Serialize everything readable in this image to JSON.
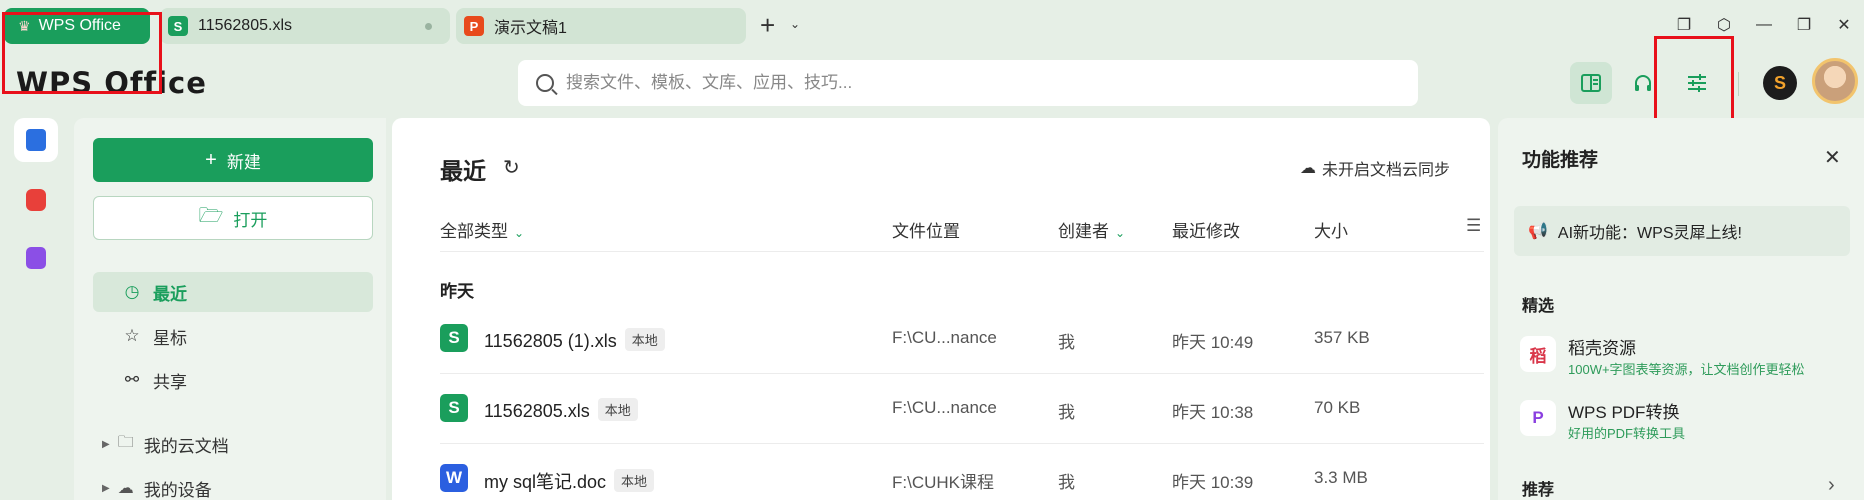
{
  "tabs": [
    {
      "label": "WPS Office",
      "icon": "wps-logo-icon"
    },
    {
      "label": "11562805.xls",
      "badge": "S",
      "color": "#1a9e5c"
    },
    {
      "label": "演示文稿1",
      "badge": "P",
      "color": "#e84a1c"
    }
  ],
  "header": {
    "logo": "WPS Office",
    "search_placeholder": "搜索文件、模板、文库、应用、技巧..."
  },
  "sidebar": {
    "new_label": "新建",
    "open_label": "打开",
    "nav": [
      {
        "label": "最近",
        "icon": "clock-icon",
        "active": true
      },
      {
        "label": "星标",
        "icon": "star-icon"
      },
      {
        "label": "共享",
        "icon": "share-icon"
      }
    ],
    "tree": [
      {
        "label": "我的云文档",
        "icon": "folder-icon"
      },
      {
        "label": "我的设备",
        "icon": "device-icon"
      }
    ]
  },
  "main": {
    "title": "最近",
    "cloud_sync": "未开启文档云同步",
    "columns": {
      "type": "全部类型",
      "location": "文件位置",
      "creator": "创建者",
      "modified": "最近修改",
      "size": "大小"
    },
    "group": "昨天",
    "files": [
      {
        "badge": "S",
        "color": "#1a9e5c",
        "name": "11562805 (1).xls",
        "tag": "本地",
        "location": "F:\\CU...nance",
        "creator": "我",
        "modified": "昨天 10:49",
        "size": "357 KB"
      },
      {
        "badge": "S",
        "color": "#1a9e5c",
        "name": "11562805.xls",
        "tag": "本地",
        "location": "F:\\CU...nance",
        "creator": "我",
        "modified": "昨天 10:38",
        "size": "70 KB"
      },
      {
        "badge": "W",
        "color": "#2b5fe0",
        "name": "my sql笔记.doc",
        "tag": "本地",
        "location": "F:\\CUHK课程",
        "creator": "我",
        "modified": "昨天 10:39",
        "size": "3.3 MB"
      }
    ]
  },
  "right_panel": {
    "title": "功能推荐",
    "ai_banner": "AI新功能：WPS灵犀上线!",
    "section_featured": "精选",
    "items": [
      {
        "name": "稻壳资源",
        "desc": "100W+字图表等资源，让文档创作更轻松",
        "badge": "稻",
        "color": "#d9364a"
      },
      {
        "name": "WPS PDF转换",
        "desc": "好用的PDF转换工具",
        "badge": "P",
        "color": "#8a3fe0"
      }
    ],
    "section_recommend": "推荐"
  },
  "colors": {
    "accent": "#1a9e5c",
    "highlight": "#e8101a"
  }
}
